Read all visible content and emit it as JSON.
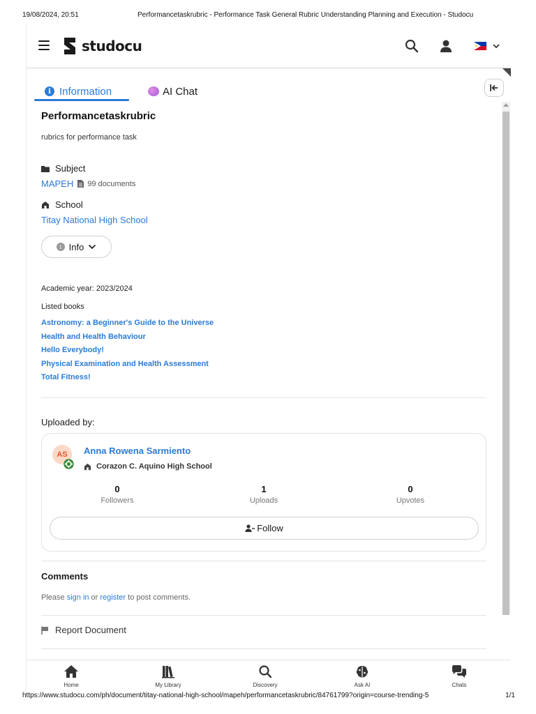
{
  "print": {
    "date": "19/08/2024, 20:51",
    "title": "Performancetaskrubric - Performance Task General Rubric Understanding Planning and Execution - Studocu",
    "url": "https://www.studocu.com/ph/document/titay-national-high-school/mapeh/performancetaskrubric/84761799?origin=course-trending-5",
    "page": "1/1"
  },
  "header": {
    "logo_text": "studocu",
    "icons": {
      "menu": "hamburger-icon",
      "search": "search-icon",
      "user": "user-icon",
      "language": "philippines-flag-icon"
    }
  },
  "tabs": [
    {
      "label": "Information",
      "icon": "info-icon",
      "active": true
    },
    {
      "label": "AI Chat",
      "icon": "ai-chat-icon",
      "active": false
    }
  ],
  "document": {
    "title": "Performancetaskrubric",
    "description": "rubrics for performance task",
    "subject_label": "Subject",
    "subject": "MAPEH",
    "subject_doc_count": "99 documents",
    "school_label": "School",
    "school": "Titay National High School",
    "info_button": "Info",
    "academic_year": "Academic year: 2023/2024",
    "listed_books_label": "Listed books",
    "books": [
      "Astronomy: a Beginner's Guide to the Universe",
      "Health and Health Behaviour",
      "Hello Everybody!",
      "Physical Examination and Health Assessment",
      "Total Fitness!"
    ]
  },
  "uploader": {
    "section_label": "Uploaded by:",
    "initials": "AS",
    "name": "Anna Rowena Sarmiento",
    "school": "Corazon C. Aquino High School",
    "stats": [
      {
        "value": "0",
        "label": "Followers"
      },
      {
        "value": "1",
        "label": "Uploads"
      },
      {
        "value": "0",
        "label": "Upvotes"
      }
    ],
    "follow_label": "Follow"
  },
  "comments": {
    "title": "Comments",
    "prefix": "Please ",
    "sign_in": "sign in",
    "middle": " or ",
    "register": "register",
    "suffix": " to post comments."
  },
  "report_label": "Report Document",
  "nav": [
    {
      "label": "Home",
      "icon": "home-icon"
    },
    {
      "label": "My Library",
      "icon": "library-icon"
    },
    {
      "label": "Discovery",
      "icon": "discovery-search-icon"
    },
    {
      "label": "Ask AI",
      "icon": "brain-icon"
    },
    {
      "label": "Chats",
      "icon": "chats-icon"
    }
  ],
  "colors": {
    "accent": "#2b7bd6",
    "avatar_bg": "#fbd9c7",
    "avatar_text": "#e2582b",
    "badge": "#3a8a3a"
  }
}
